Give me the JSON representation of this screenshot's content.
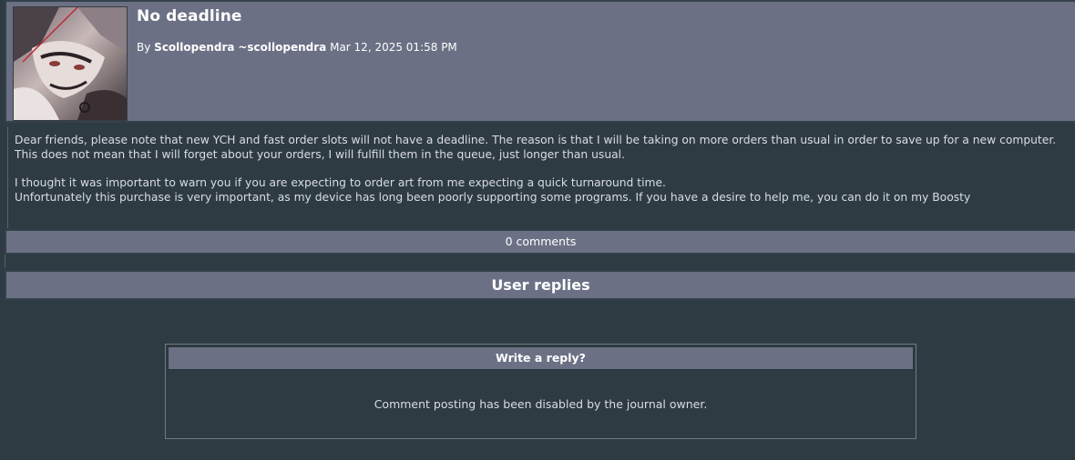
{
  "journal": {
    "title": "No deadline",
    "by_label": "By",
    "author": "Scollopendra",
    "username": "~scollopendra",
    "date": "Mar 12, 2025 01:58 PM",
    "body": {
      "line1": "Dear friends, please note that new YCH and fast order slots will not have a deadline. The reason is that I will be taking on more orders than usual in order to save up for a new computer.",
      "line2": "This does not mean that I will forget about your orders, I will fulfill them in the queue, just longer than usual.",
      "line3": "I thought it was important to warn you if you are expecting to order art from me expecting a quick turnaround time.",
      "line4": "Unfortunately this purchase is very important, as my device has long been poorly supporting some programs. If you have a desire to help me, you can do it on my Boosty"
    }
  },
  "comments": {
    "count_label": "0 comments"
  },
  "replies": {
    "section_title": "User replies",
    "box_title": "Write a reply?",
    "disabled_message": "Comment posting has been disabled by the journal owner."
  },
  "colors": {
    "page_background": "#2e3b43",
    "header_bar": "#6b7085",
    "text_light": "#d9dde0"
  }
}
